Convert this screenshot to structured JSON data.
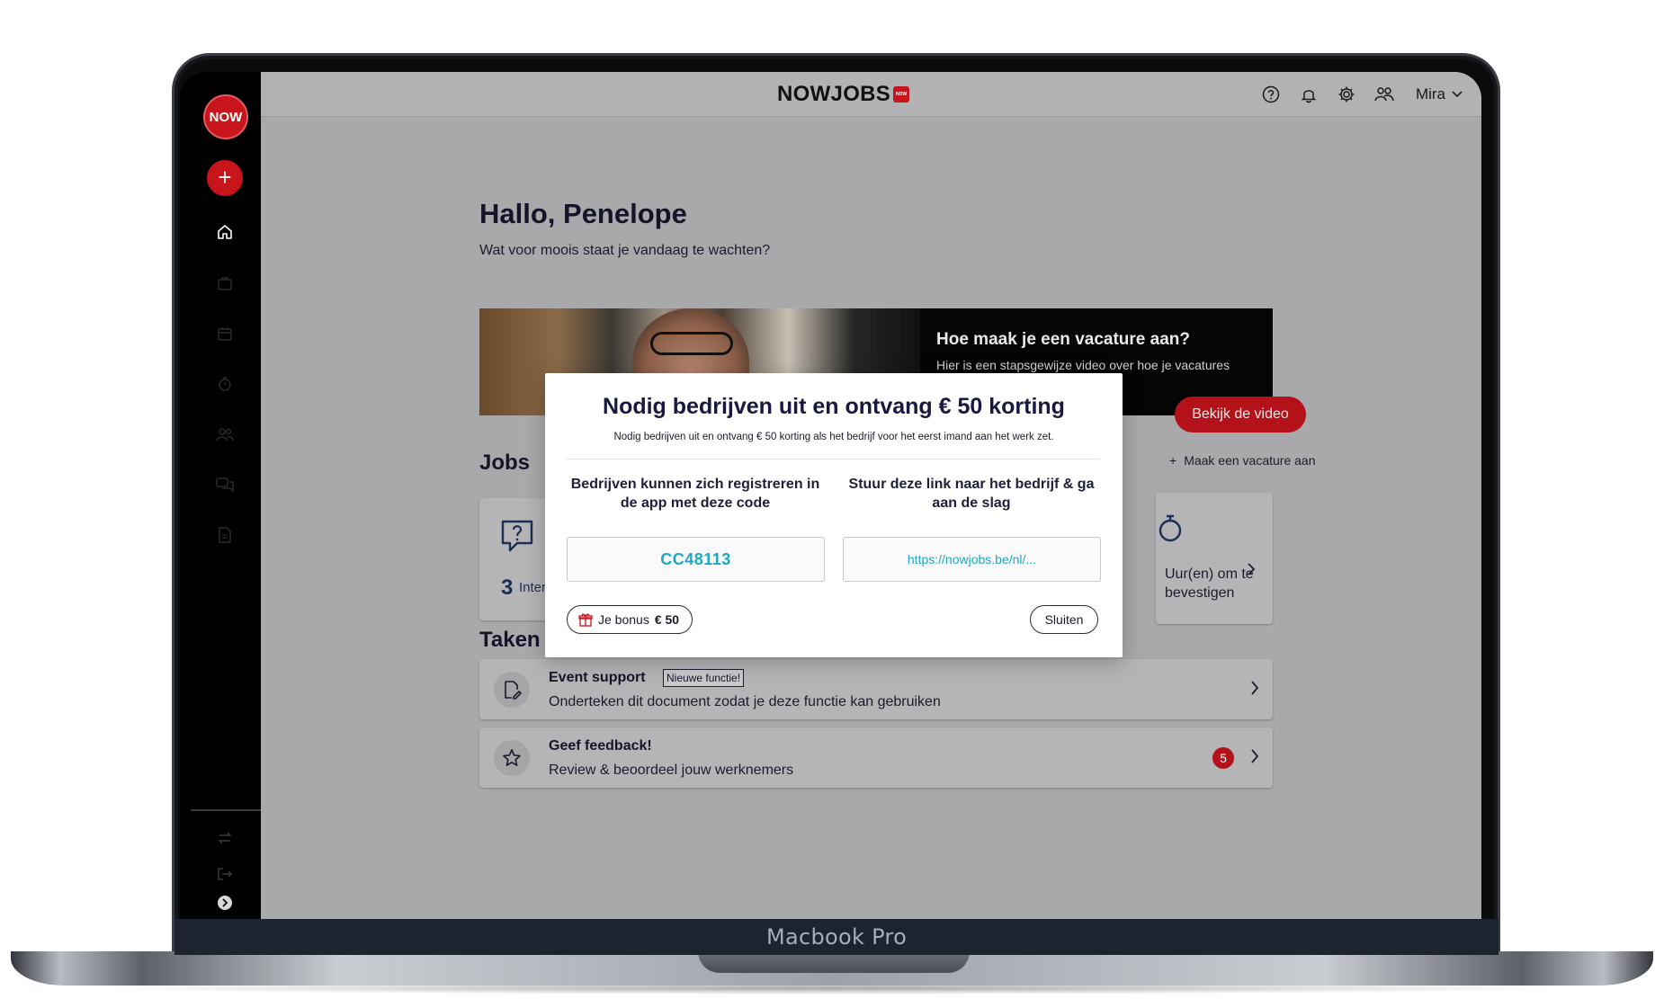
{
  "device": {
    "label": "Macbook Pro"
  },
  "sidebar": {
    "brand": "NOW",
    "add_symbol": "+",
    "items": [
      {
        "icon": "home-icon"
      },
      {
        "icon": "briefcase-icon"
      },
      {
        "icon": "calendar-icon"
      },
      {
        "icon": "stopwatch-icon"
      },
      {
        "icon": "people-icon"
      },
      {
        "icon": "chat-icon"
      },
      {
        "icon": "document-icon"
      }
    ],
    "bottom": [
      {
        "icon": "switch-icon"
      },
      {
        "icon": "logout-icon"
      },
      {
        "icon": "expand-icon"
      }
    ]
  },
  "header": {
    "logo_text": "NOWJOBS",
    "logo_mark": "NOW",
    "user_name": "Mira",
    "icons": [
      "help-icon",
      "bell-icon",
      "gear-icon",
      "team-icon",
      "chevron-down-icon"
    ]
  },
  "main": {
    "greeting": "Hallo, Penelope",
    "subgreeting": "Wat voor moois staat je vandaag te wachten?",
    "banner": {
      "title": "Hoe maak je een vacature aan?",
      "text": "Hier is een stapsgewijze video over hoe je vacatures",
      "button": "Bekijk de video"
    },
    "jobs": {
      "title": "Jobs",
      "new_link": "Maak een vacature aan",
      "card_left": {
        "count": "3",
        "label": "Inter"
      },
      "card_right": {
        "label_line1": "Uur(en) om te",
        "label_line2": "bevestigen"
      }
    },
    "tasks": {
      "title": "Taken",
      "items": [
        {
          "title": "Event support",
          "badge": "Nieuwe functie!",
          "desc": "Onderteken dit document zodat je deze functie kan gebruiken"
        },
        {
          "title": "Geef feedback!",
          "desc": "Review & beoordeel jouw werknemers",
          "count": "5"
        }
      ]
    }
  },
  "modal": {
    "title": "Nodig bedrijven uit en ontvang € 50 korting",
    "subtitle": "Nodig bedrijven uit en ontvang € 50 korting als het bedrijf voor het eerst imand aan het werk zet.",
    "left_head": "Bedrijven kunnen zich registreren in de app met deze code",
    "right_head": "Stuur deze link naar het bedrijf & ga aan de slag",
    "code": "CC48113",
    "link": "https://nowjobs.be/nl/...",
    "bonus_label": "Je bonus",
    "bonus_amount": "€ 50",
    "close": "Sluiten"
  },
  "colors": {
    "brand_red": "#c8141b",
    "link_teal": "#1fa8c6",
    "navy": "#181840"
  }
}
